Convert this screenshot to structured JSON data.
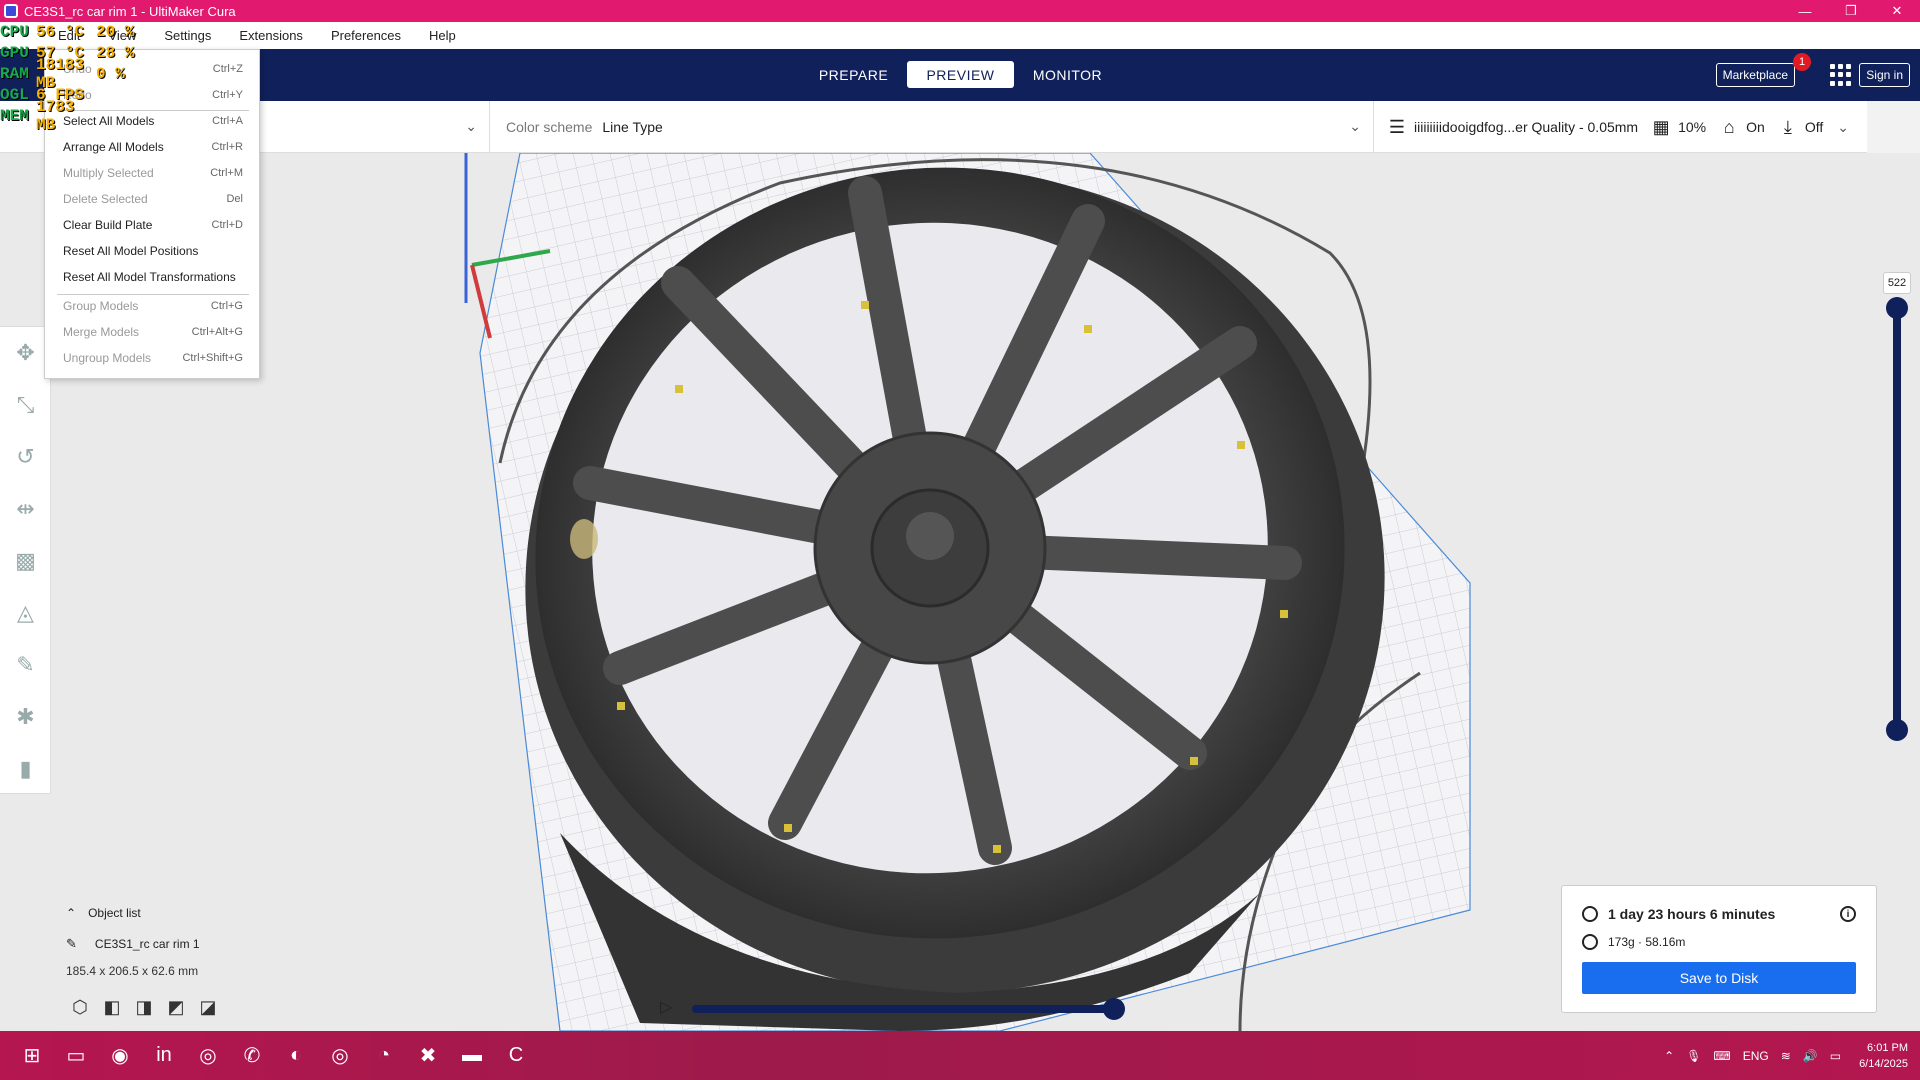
{
  "window": {
    "title": "CE3S1_rc car rim 1 - UltiMaker Cura",
    "minimize": "—",
    "restore": "❐",
    "close": "✕"
  },
  "menu": {
    "items": [
      "Edit",
      "View",
      "Settings",
      "Extensions",
      "Preferences",
      "Help"
    ]
  },
  "header": {
    "stages": [
      "PREPARE",
      "PREVIEW",
      "MONITOR"
    ],
    "active_stage": "PREVIEW",
    "marketplace": "Marketplace",
    "marketplace_badge": "1",
    "signin": "Sign in"
  },
  "topbar": {
    "color_scheme_label": "Color scheme",
    "color_scheme_value": "Line Type",
    "profile": "iiiiiiiiidooigdfog...er Quality - 0.05mm",
    "infill": "10%",
    "support": "On",
    "adhesion": "Off"
  },
  "edit_menu": {
    "items": [
      {
        "label": "Undo",
        "shortcut": "Ctrl+Z",
        "enabled": false
      },
      {
        "label": "Redo",
        "shortcut": "Ctrl+Y",
        "enabled": false
      },
      {
        "label": "Select All Models",
        "shortcut": "Ctrl+A",
        "enabled": true
      },
      {
        "label": "Arrange All Models",
        "shortcut": "Ctrl+R",
        "enabled": true
      },
      {
        "label": "Multiply Selected",
        "shortcut": "Ctrl+M",
        "enabled": false
      },
      {
        "label": "Delete Selected",
        "shortcut": "Del",
        "enabled": false
      },
      {
        "label": "Clear Build Plate",
        "shortcut": "Ctrl+D",
        "enabled": true
      },
      {
        "label": "Reset All Model Positions",
        "shortcut": "",
        "enabled": true
      },
      {
        "label": "Reset All Model Transformations",
        "shortcut": "",
        "enabled": true
      },
      {
        "label": "Group Models",
        "shortcut": "Ctrl+G",
        "enabled": false
      },
      {
        "label": "Merge Models",
        "shortcut": "Ctrl+Alt+G",
        "enabled": false
      },
      {
        "label": "Ungroup Models",
        "shortcut": "Ctrl+Shift+G",
        "enabled": false
      }
    ]
  },
  "hw_monitor": {
    "rows": [
      {
        "label": "CPU",
        "v1": "56 °C",
        "v2": "20 %"
      },
      {
        "label": "GPU",
        "v1": "57 °C",
        "v2": "28 %"
      },
      {
        "label": "RAM",
        "v1": "18183 MB",
        "v2": "0 %"
      },
      {
        "label": "OGL",
        "v1": "6 FPS",
        "v2": ""
      },
      {
        "label": "MEM",
        "v1": "1783 MB",
        "v2": ""
      }
    ]
  },
  "layer_slider": {
    "current_layer": "522"
  },
  "object_list": {
    "header": "Object list",
    "object_name": "CE3S1_rc car rim 1",
    "dimensions": "185.4 x 206.5 x 62.6 mm"
  },
  "estimate": {
    "time": "1 day 23 hours 6 minutes",
    "material": "173g · 58.16m",
    "save_button": "Save to Disk"
  },
  "taskbar": {
    "language": "ENG",
    "time": "6:01 PM",
    "date": "6/14/2025"
  },
  "colors": {
    "titlebar": "#e1196f",
    "header": "#10205a",
    "accent": "#196ef0",
    "taskbar": "#b5164f"
  }
}
